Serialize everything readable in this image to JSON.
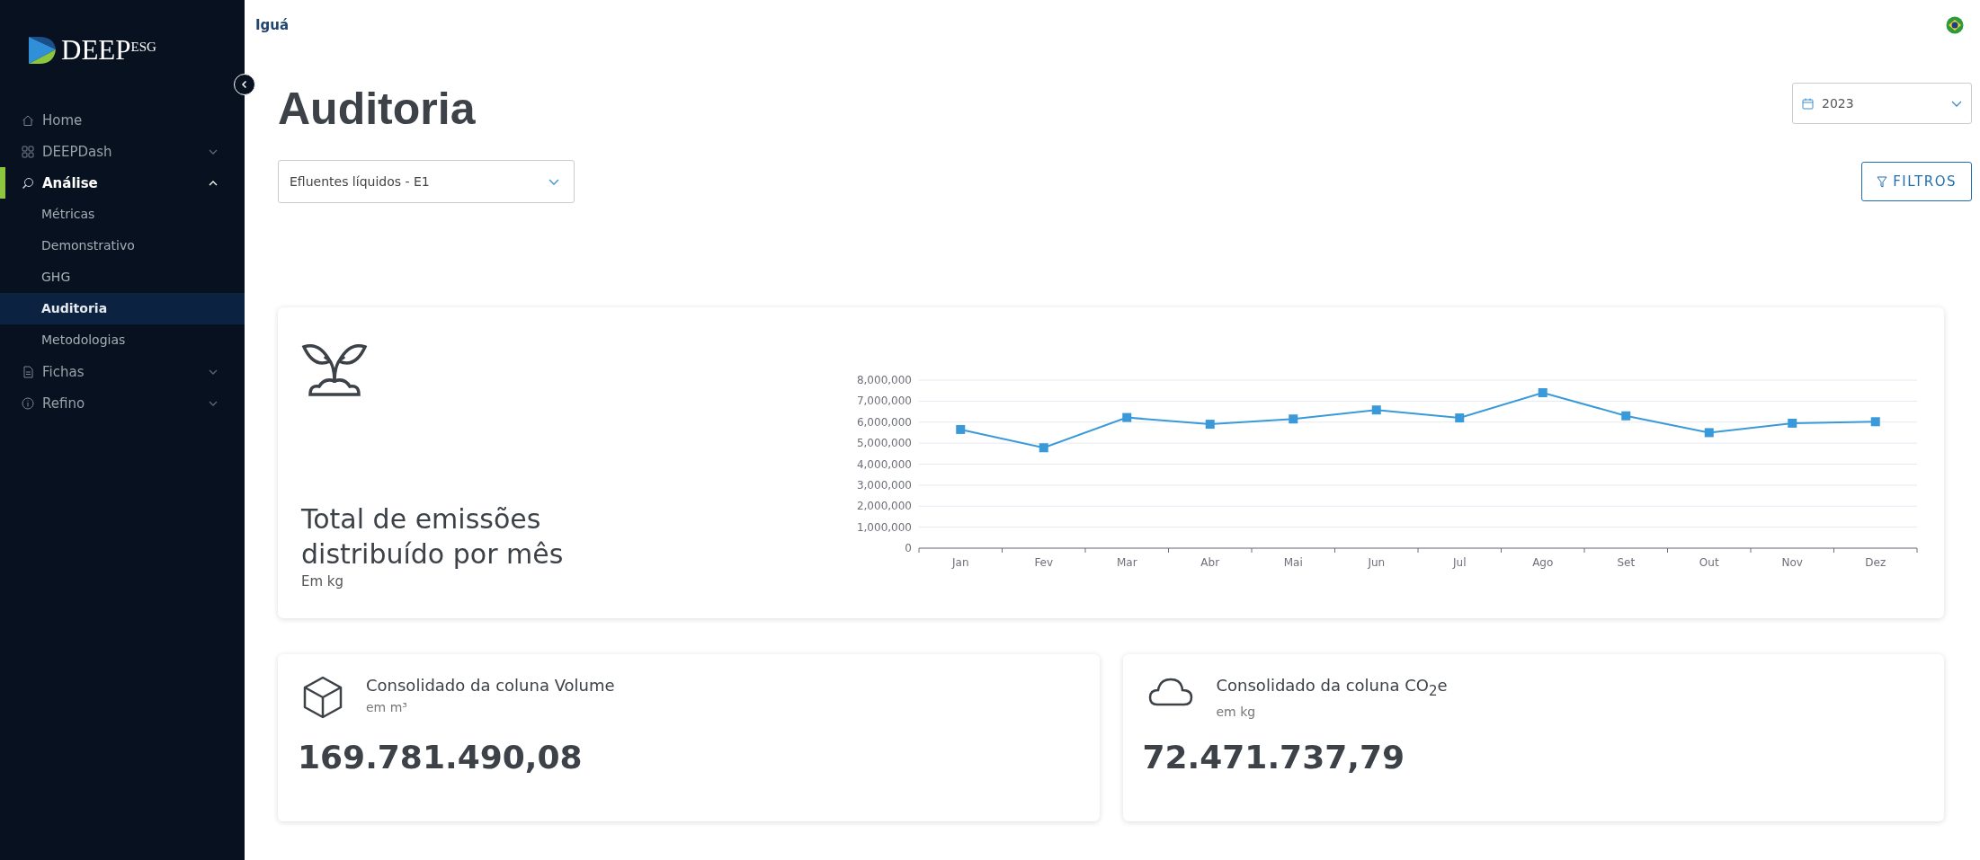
{
  "sidebar": {
    "logo": {
      "text": "DEEP",
      "sup": "ESG"
    },
    "items": [
      {
        "label": "Home",
        "kind": "link",
        "selected": false
      },
      {
        "label": "DEEPDash",
        "kind": "group",
        "expanded": false,
        "selected": false
      },
      {
        "label": "Análise",
        "kind": "group",
        "expanded": true,
        "selected": true,
        "children": [
          {
            "label": "Métricas",
            "selected": false
          },
          {
            "label": "Demonstrativo",
            "selected": false
          },
          {
            "label": "GHG",
            "selected": false
          },
          {
            "label": "Auditoria",
            "selected": true
          },
          {
            "label": "Metodologias",
            "selected": false
          }
        ]
      },
      {
        "label": "Fichas",
        "kind": "group",
        "expanded": false,
        "selected": false
      },
      {
        "label": "Refino",
        "kind": "group",
        "expanded": false,
        "selected": false
      }
    ]
  },
  "header": {
    "company": "Iguá"
  },
  "page": {
    "title": "Auditoria",
    "year": "2023",
    "indicator": "Efluentes líquidos - E1",
    "filters_button": "FILTROS"
  },
  "chart_card": {
    "title": "Total de emissões distribuído por mês",
    "unit": "Em kg",
    "chart_data": {
      "type": "line",
      "categories": [
        "Jan",
        "Fev",
        "Mar",
        "Abr",
        "Mai",
        "Jun",
        "Jul",
        "Ago",
        "Set",
        "Out",
        "Nov",
        "Dez"
      ],
      "grid": true,
      "series": [
        {
          "color": "#3a9ad9",
          "marker": "square",
          "values": [
            5650000,
            4780000,
            6220000,
            5900000,
            6150000,
            6580000,
            6200000,
            7400000,
            6300000,
            5500000,
            5950000,
            6020000
          ]
        }
      ],
      "ylim": [
        0,
        8000000
      ],
      "yticks": [
        {
          "value": 0,
          "label": "0"
        },
        {
          "value": 1000000,
          "label": "1,000,000"
        },
        {
          "value": 2000000,
          "label": "2,000,000"
        },
        {
          "value": 3000000,
          "label": "3,000,000"
        },
        {
          "value": 4000000,
          "label": "4,000,000"
        },
        {
          "value": 5000000,
          "label": "5,000,000"
        },
        {
          "value": 6000000,
          "label": "6,000,000"
        },
        {
          "value": 7000000,
          "label": "7,000,000"
        },
        {
          "value": 8000000,
          "label": "8,000,000"
        }
      ]
    }
  },
  "stat_cards": [
    {
      "kind": "cube",
      "title": "Consolidado da coluna Volume",
      "unit": "em m³",
      "value": "169.781.490,08"
    },
    {
      "kind": "cloud",
      "title": "Consolidado da coluna CO$_{2}$e",
      "unit": "em kg",
      "value": "72.471.737,79"
    }
  ]
}
